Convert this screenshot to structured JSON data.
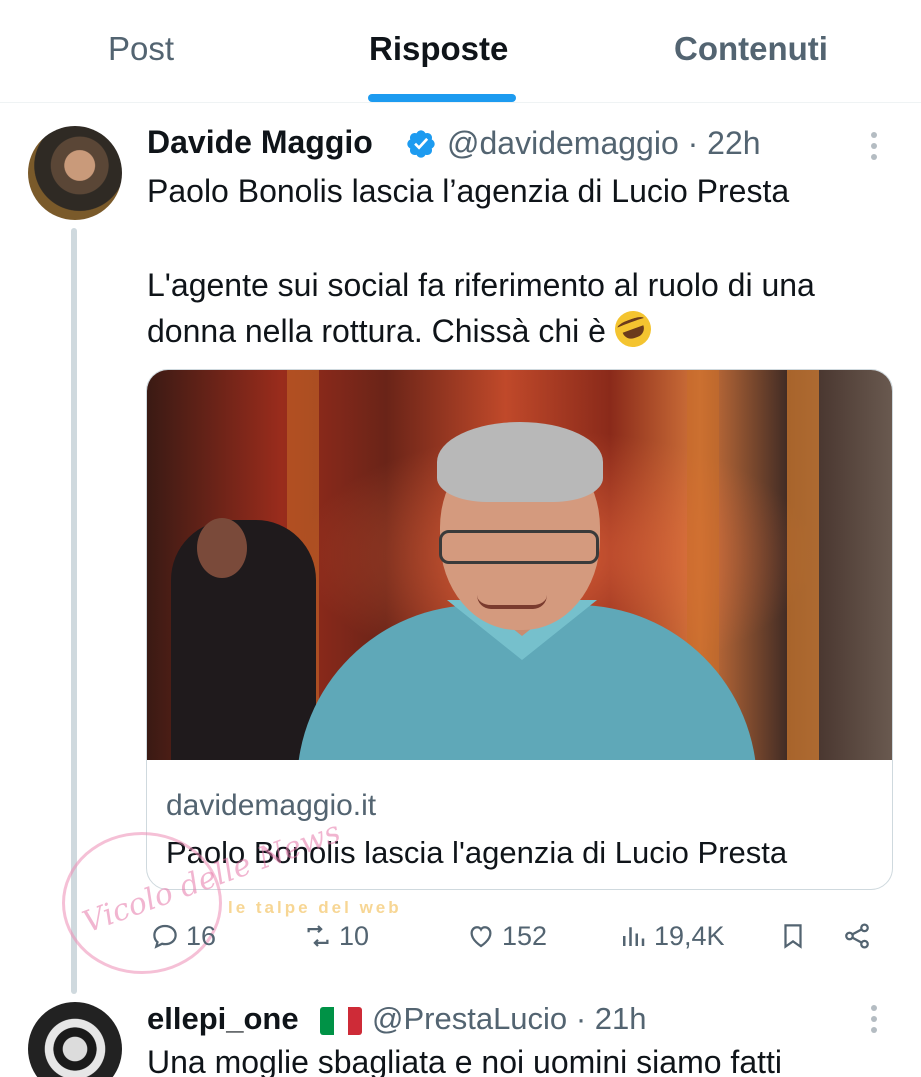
{
  "tabs": [
    {
      "label": "Post",
      "active": false
    },
    {
      "label": "Risposte",
      "active": true
    },
    {
      "label": "Contenuti",
      "active": false
    }
  ],
  "accent_color": "#1d9bf0",
  "post": {
    "author_name": "Davide Maggio",
    "verified": true,
    "handle": "@davidemaggio",
    "separator": "·",
    "time": "22h",
    "text_lines": [
      "Paolo Bonolis lascia l’agenzia di Lucio Presta",
      "L'agente sui social fa riferimento al ruolo di una",
      "donna nella rottura. Chissà chi è"
    ],
    "emoji": "rolling-on-floor-laughing",
    "card": {
      "domain": "davidemaggio.it",
      "title": "Paolo Bonolis lascia l'agenzia di Lucio Presta"
    },
    "actions": {
      "replies": "16",
      "reposts": "10",
      "likes": "152",
      "views": "19,4K"
    }
  },
  "watermark": {
    "script_text": "Vicolo delle News",
    "band_text": "le talpe del web"
  },
  "reply": {
    "author_name": "ellepi_one",
    "flag": "Italy",
    "handle": "@PrestaLucio",
    "separator": "·",
    "time": "21h",
    "text": "Una moglie sbagliata e noi uomini siamo fatti"
  }
}
